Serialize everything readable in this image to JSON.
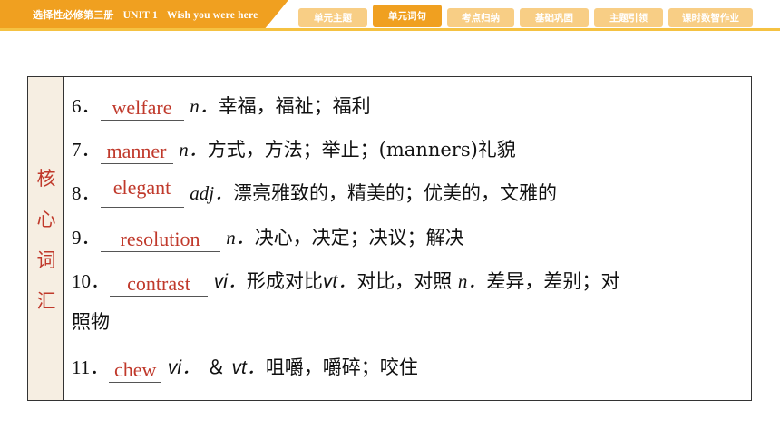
{
  "header": {
    "book": "选择性必修第三册",
    "unit": "UNIT 1",
    "unit_name": "Wish you were here"
  },
  "nav_tabs": [
    {
      "label": "单元主题",
      "active": false
    },
    {
      "label": "单元词句",
      "active": true
    },
    {
      "label": "考点归纳",
      "active": false
    },
    {
      "label": "基础巩固",
      "active": false
    },
    {
      "label": "主题引领",
      "active": false
    },
    {
      "label": "课时数智作业",
      "active": false
    }
  ],
  "side_label": [
    "核",
    "心",
    "词",
    "汇"
  ],
  "entries": [
    {
      "num": "6．",
      "answer": "welfare",
      "pos": "n．",
      "meaning": "幸福，福祉；福利"
    },
    {
      "num": "7．",
      "answer": "manner",
      "pos": "n．",
      "meaning": "方式，方法；举止；(manners)礼貌"
    },
    {
      "num": "8．",
      "answer": "elegant",
      "pos": "adj．",
      "meaning": "漂亮雅致的，精美的；优美的，文雅的"
    },
    {
      "num": "9．",
      "answer": "resolution",
      "pos": "n．",
      "meaning": "决心，决定；决议；解决"
    },
    {
      "num": "10．",
      "answer": "contrast",
      "pos1": "vi．",
      "meaning1": "形成对比",
      "pos2": "vt．",
      "meaning2": "对比，对照",
      "pos3": "n．",
      "meaning3": "差异，差别；对",
      "cont": "照物"
    },
    {
      "num": "11．",
      "answer": "chew",
      "pos1": "vi．",
      "mid": "＆",
      "pos2": "vt．",
      "meaning": "咀嚼，嚼碎；咬住"
    }
  ],
  "colors": {
    "accent": "#f0a020",
    "tab_inactive": "#f8ce85",
    "answer": "#c0392b",
    "side_bg": "#f6eee2"
  }
}
